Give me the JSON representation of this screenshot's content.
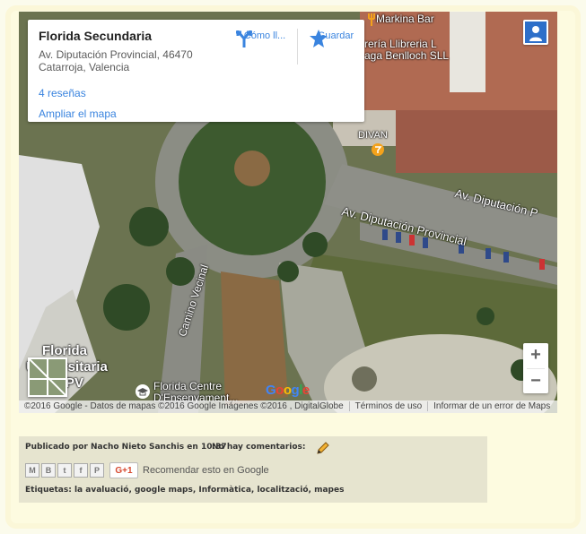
{
  "map": {
    "place": {
      "title": "Florida Secundaria",
      "address": "Av. Diputación Provincial, 46470 Catarroja, Valencia",
      "reviews": "4 reseñas",
      "enlarge": "Ampliar el mapa"
    },
    "actions": {
      "directions": "Cómo ll...",
      "save": "Guardar"
    },
    "labels": {
      "poi_bar": "Markina Bar",
      "poi_shop_1": "rería Llibreria L",
      "poi_shop_2": "aga Benlloch SLL",
      "divan": "DIVAN",
      "street_1": "Av. Diputación P",
      "street_2": "Av. Diputación Provincial",
      "camino": "Camino Vecinal",
      "univ_1": "Florida",
      "univ_2": "Universitaria",
      "univ_3": "PV",
      "centre_1": "Florida Centre",
      "centre_2": "D'Ensenyament..."
    },
    "zoom": {
      "in": "+",
      "out": "−"
    },
    "google_logo": "Google",
    "attribution": {
      "data": "©2016 Google - Datos de mapas ©2016 Google Imágenes ©2016 , DigitalGlobe",
      "terms": "Términos de uso",
      "report": "Informar de un error de Maps"
    },
    "colors": {
      "link": "#3a84df",
      "accent_star": "#3a84df"
    }
  },
  "post": {
    "published_by": "Publicado por",
    "author": "Nacho Nieto Sanchis",
    "at": "en",
    "time": "10:37",
    "comments": "No hay comentarios:",
    "share_icons": [
      "email-icon",
      "blogger-icon",
      "twitter-icon",
      "facebook-icon",
      "pinterest-icon"
    ],
    "share_glyphs": [
      "M",
      "B",
      "t",
      "f",
      "P"
    ],
    "gplus": "G+1",
    "recommend": "Recomendar esto en Google",
    "labels_prefix": "Etiquetas:",
    "labels": "la avaluació, google maps, Informàtica, localització, mapes"
  }
}
